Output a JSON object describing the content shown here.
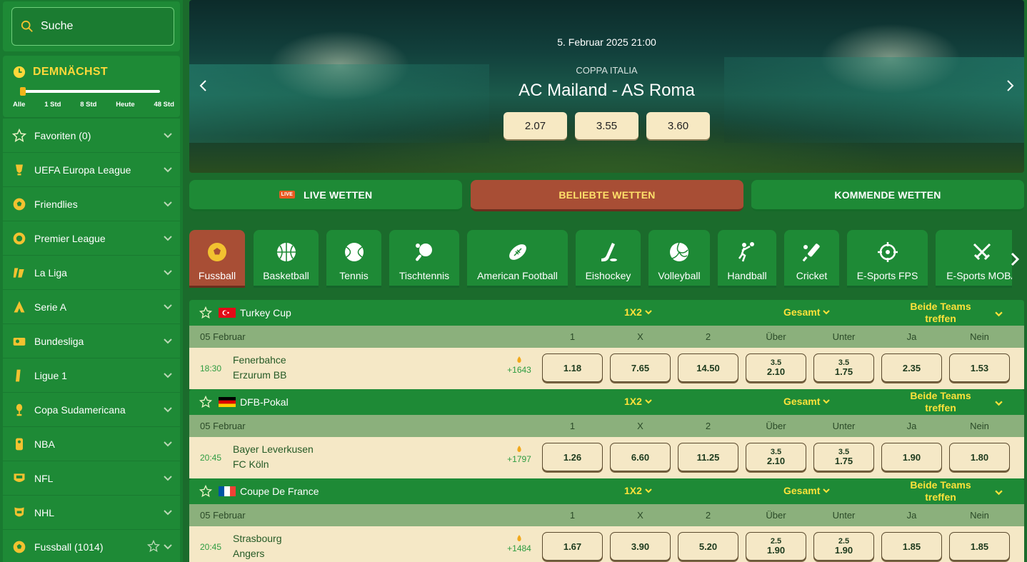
{
  "sidebar": {
    "search_label": "Suche",
    "soon": {
      "title": "DEMNÄCHST",
      "slider_labels": [
        "Alle",
        "1 Std",
        "8 Std",
        "Heute",
        "48 Std"
      ],
      "selected": "Alle"
    },
    "items": [
      {
        "label": "Favoriten (0)",
        "icon": "star-icon"
      },
      {
        "label": "UEFA Europa League",
        "icon": "europa-league-icon"
      },
      {
        "label": "Friendlies",
        "icon": "soccer-ball-icon"
      },
      {
        "label": "Premier League",
        "icon": "premier-league-icon"
      },
      {
        "label": "La Liga",
        "icon": "la-liga-icon"
      },
      {
        "label": "Serie A",
        "icon": "serie-a-icon"
      },
      {
        "label": "Bundesliga",
        "icon": "bundesliga-icon"
      },
      {
        "label": "Ligue 1",
        "icon": "ligue-1-icon"
      },
      {
        "label": "Copa Sudamericana",
        "icon": "trophy-icon"
      },
      {
        "label": "NBA",
        "icon": "nba-icon"
      },
      {
        "label": "NFL",
        "icon": "nfl-icon"
      },
      {
        "label": "NHL",
        "icon": "nhl-icon"
      },
      {
        "label": "Fussball (1014)",
        "icon": "soccer-ball-icon"
      }
    ]
  },
  "hero": {
    "date": "5. Februar 2025 21:00",
    "competition": "COPPA ITALIA",
    "match": "AC Mailand  -  AS Roma",
    "odds": [
      "2.07",
      "3.55",
      "3.60"
    ]
  },
  "main_tabs": {
    "live": "LIVE WETTEN",
    "live_badge": "LIVE",
    "popular": "BELIEBTE WETTEN",
    "upcoming": "KOMMENDE WETTEN"
  },
  "sports": [
    "Fussball",
    "Basketball",
    "Tennis",
    "Tischtennis",
    "American Football",
    "Eishockey",
    "Volleyball",
    "Handball",
    "Cricket",
    "E-Sports FPS",
    "E-Sports MOBA"
  ],
  "markets": {
    "m1": "1X2",
    "m2": "Gesamt",
    "m3": "Beide Teams treffen"
  },
  "headers": [
    "1",
    "X",
    "2",
    "Über",
    "Unter",
    "Ja",
    "Nein"
  ],
  "events": [
    {
      "competition": "Turkey Cup",
      "flag": "tr",
      "date": "05 Februar",
      "time": "18:30",
      "team1": "Fenerbahce",
      "team2": "Erzurum BB",
      "more": "+1643",
      "o1": "1.18",
      "ox": "7.65",
      "o2": "14.50",
      "over_line": "3.5",
      "over": "2.10",
      "under_line": "3.5",
      "under": "1.75",
      "yes": "2.35",
      "no": "1.53"
    },
    {
      "competition": "DFB-Pokal",
      "flag": "de",
      "date": "05 Februar",
      "time": "20:45",
      "team1": "Bayer Leverkusen",
      "team2": "FC Köln",
      "more": "+1797",
      "o1": "1.26",
      "ox": "6.60",
      "o2": "11.25",
      "over_line": "3.5",
      "over": "2.10",
      "under_line": "3.5",
      "under": "1.75",
      "yes": "1.90",
      "no": "1.80"
    },
    {
      "competition": "Coupe De France",
      "flag": "fr",
      "date": "05 Februar",
      "time": "20:45",
      "team1": "Strasbourg",
      "team2": "Angers",
      "more": "+1484",
      "o1": "1.67",
      "ox": "3.90",
      "o2": "5.20",
      "over_line": "2.5",
      "over": "1.90",
      "under_line": "2.5",
      "under": "1.90",
      "yes": "1.85",
      "no": "1.85"
    }
  ]
}
